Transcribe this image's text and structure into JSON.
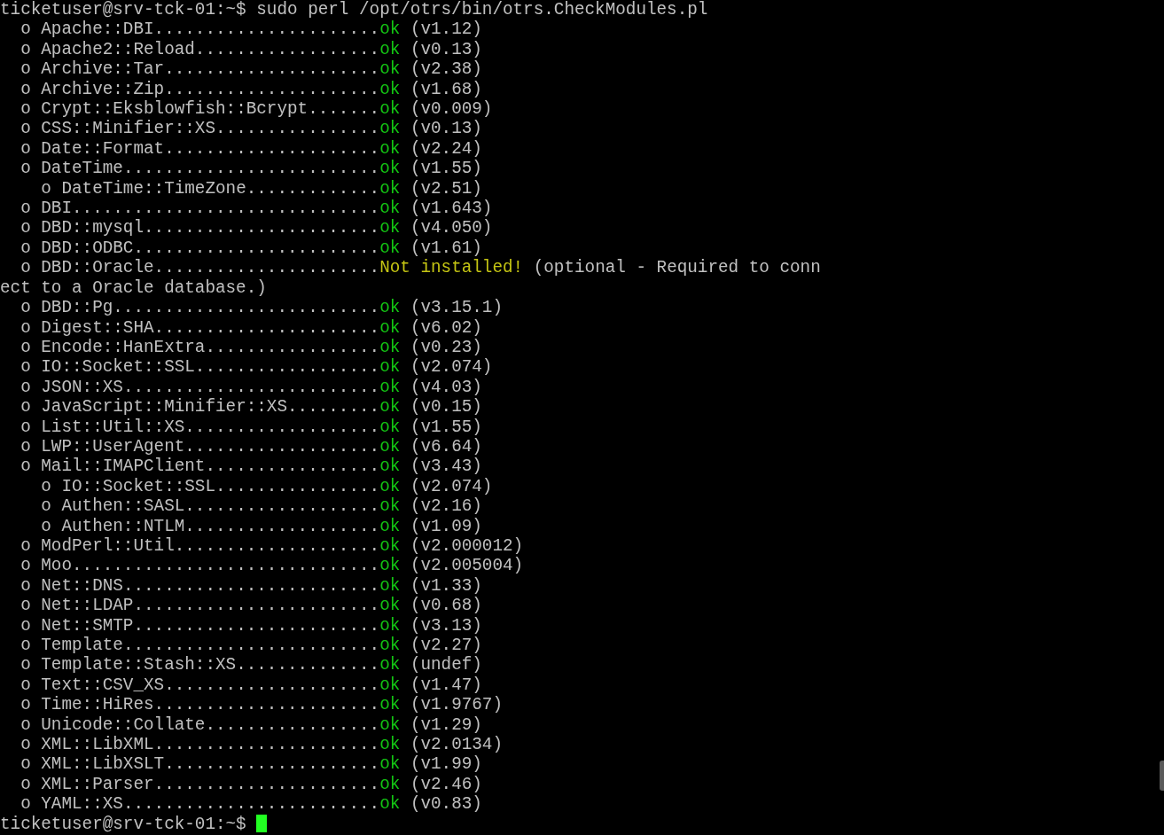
{
  "terminal": {
    "prompt": "ticketuser@srv-tck-01:~$",
    "command": "sudo perl /opt/otrs/bin/otrs.CheckModules.pl",
    "modules": [
      {
        "bullet": "o",
        "name": "Apache::DBI",
        "leader": "......................",
        "status": "ok",
        "kind": "success",
        "detail": "(v1.12)"
      },
      {
        "bullet": "o",
        "name": "Apache2::Reload",
        "leader": "..................",
        "status": "ok",
        "kind": "success",
        "detail": "(v0.13)"
      },
      {
        "bullet": "o",
        "name": "Archive::Tar",
        "leader": ".....................",
        "status": "ok",
        "kind": "success",
        "detail": "(v2.38)"
      },
      {
        "bullet": "o",
        "name": "Archive::Zip",
        "leader": ".....................",
        "status": "ok",
        "kind": "success",
        "detail": "(v1.68)"
      },
      {
        "bullet": "o",
        "name": "Crypt::Eksblowfish::Bcrypt",
        "leader": ".......",
        "status": "ok",
        "kind": "success",
        "detail": "(v0.009)"
      },
      {
        "bullet": "o",
        "name": "CSS::Minifier::XS",
        "leader": "................",
        "status": "ok",
        "kind": "success",
        "detail": "(v0.13)"
      },
      {
        "bullet": "o",
        "name": "Date::Format",
        "leader": ".....................",
        "status": "ok",
        "kind": "success",
        "detail": "(v2.24)"
      },
      {
        "bullet": "o",
        "name": "DateTime",
        "leader": ".........................",
        "status": "ok",
        "kind": "success",
        "detail": "(v1.55)",
        "children": [
          {
            "bullet": "o",
            "name": "DateTime::TimeZone",
            "leader": ".............",
            "status": "ok",
            "kind": "success",
            "detail": "(v2.51)"
          }
        ]
      },
      {
        "bullet": "o",
        "name": "DBI",
        "leader": "..............................",
        "status": "ok",
        "kind": "success",
        "detail": "(v1.643)"
      },
      {
        "bullet": "o",
        "name": "DBD::mysql",
        "leader": ".......................",
        "status": "ok",
        "kind": "success",
        "detail": "(v4.050)"
      },
      {
        "bullet": "o",
        "name": "DBD::ODBC",
        "leader": "........................",
        "status": "ok",
        "kind": "success",
        "detail": "(v1.61)"
      },
      {
        "bullet": "o",
        "name": "DBD::Oracle",
        "leader": "......................",
        "status": "Not installed!",
        "kind": "warning",
        "detail": "(optional - Required to conn",
        "continuation": "ect to a Oracle database.)"
      },
      {
        "bullet": "o",
        "name": "DBD::Pg",
        "leader": "..........................",
        "status": "ok",
        "kind": "success",
        "detail": "(v3.15.1)"
      },
      {
        "bullet": "o",
        "name": "Digest::SHA",
        "leader": "......................",
        "status": "ok",
        "kind": "success",
        "detail": "(v6.02)"
      },
      {
        "bullet": "o",
        "name": "Encode::HanExtra",
        "leader": ".................",
        "status": "ok",
        "kind": "success",
        "detail": "(v0.23)"
      },
      {
        "bullet": "o",
        "name": "IO::Socket::SSL",
        "leader": "..................",
        "status": "ok",
        "kind": "success",
        "detail": "(v2.074)"
      },
      {
        "bullet": "o",
        "name": "JSON::XS",
        "leader": ".........................",
        "status": "ok",
        "kind": "success",
        "detail": "(v4.03)"
      },
      {
        "bullet": "o",
        "name": "JavaScript::Minifier::XS",
        "leader": ".........",
        "status": "ok",
        "kind": "success",
        "detail": "(v0.15)"
      },
      {
        "bullet": "o",
        "name": "List::Util::XS",
        "leader": "...................",
        "status": "ok",
        "kind": "success",
        "detail": "(v1.55)"
      },
      {
        "bullet": "o",
        "name": "LWP::UserAgent",
        "leader": "...................",
        "status": "ok",
        "kind": "success",
        "detail": "(v6.64)"
      },
      {
        "bullet": "o",
        "name": "Mail::IMAPClient",
        "leader": ".................",
        "status": "ok",
        "kind": "success",
        "detail": "(v3.43)",
        "children": [
          {
            "bullet": "o",
            "name": "IO::Socket::SSL",
            "leader": "................",
            "status": "ok",
            "kind": "success",
            "detail": "(v2.074)"
          },
          {
            "bullet": "o",
            "name": "Authen::SASL",
            "leader": "...................",
            "status": "ok",
            "kind": "success",
            "detail": "(v2.16)"
          },
          {
            "bullet": "o",
            "name": "Authen::NTLM",
            "leader": "...................",
            "status": "ok",
            "kind": "success",
            "detail": "(v1.09)"
          }
        ]
      },
      {
        "bullet": "o",
        "name": "ModPerl::Util",
        "leader": "....................",
        "status": "ok",
        "kind": "success",
        "detail": "(v2.000012)"
      },
      {
        "bullet": "o",
        "name": "Moo",
        "leader": "..............................",
        "status": "ok",
        "kind": "success",
        "detail": "(v2.005004)"
      },
      {
        "bullet": "o",
        "name": "Net::DNS",
        "leader": ".........................",
        "status": "ok",
        "kind": "success",
        "detail": "(v1.33)"
      },
      {
        "bullet": "o",
        "name": "Net::LDAP",
        "leader": "........................",
        "status": "ok",
        "kind": "success",
        "detail": "(v0.68)"
      },
      {
        "bullet": "o",
        "name": "Net::SMTP",
        "leader": "........................",
        "status": "ok",
        "kind": "success",
        "detail": "(v3.13)"
      },
      {
        "bullet": "o",
        "name": "Template",
        "leader": ".........................",
        "status": "ok",
        "kind": "success",
        "detail": "(v2.27)"
      },
      {
        "bullet": "o",
        "name": "Template::Stash::XS",
        "leader": "..............",
        "status": "ok",
        "kind": "success",
        "detail": "(undef)"
      },
      {
        "bullet": "o",
        "name": "Text::CSV_XS",
        "leader": ".....................",
        "status": "ok",
        "kind": "success",
        "detail": "(v1.47)"
      },
      {
        "bullet": "o",
        "name": "Time::HiRes",
        "leader": "......................",
        "status": "ok",
        "kind": "success",
        "detail": "(v1.9767)"
      },
      {
        "bullet": "o",
        "name": "Unicode::Collate",
        "leader": ".................",
        "status": "ok",
        "kind": "success",
        "detail": "(v1.29)"
      },
      {
        "bullet": "o",
        "name": "XML::LibXML",
        "leader": "......................",
        "status": "ok",
        "kind": "success",
        "detail": "(v2.0134)"
      },
      {
        "bullet": "o",
        "name": "XML::LibXSLT",
        "leader": ".....................",
        "status": "ok",
        "kind": "success",
        "detail": "(v1.99)"
      },
      {
        "bullet": "o",
        "name": "XML::Parser",
        "leader": "......................",
        "status": "ok",
        "kind": "success",
        "detail": "(v2.46)"
      },
      {
        "bullet": "o",
        "name": "YAML::XS",
        "leader": ".........................",
        "status": "ok",
        "kind": "success",
        "detail": "(v0.83)"
      }
    ],
    "final_prompt": "ticketuser@srv-tck-01:~$"
  }
}
